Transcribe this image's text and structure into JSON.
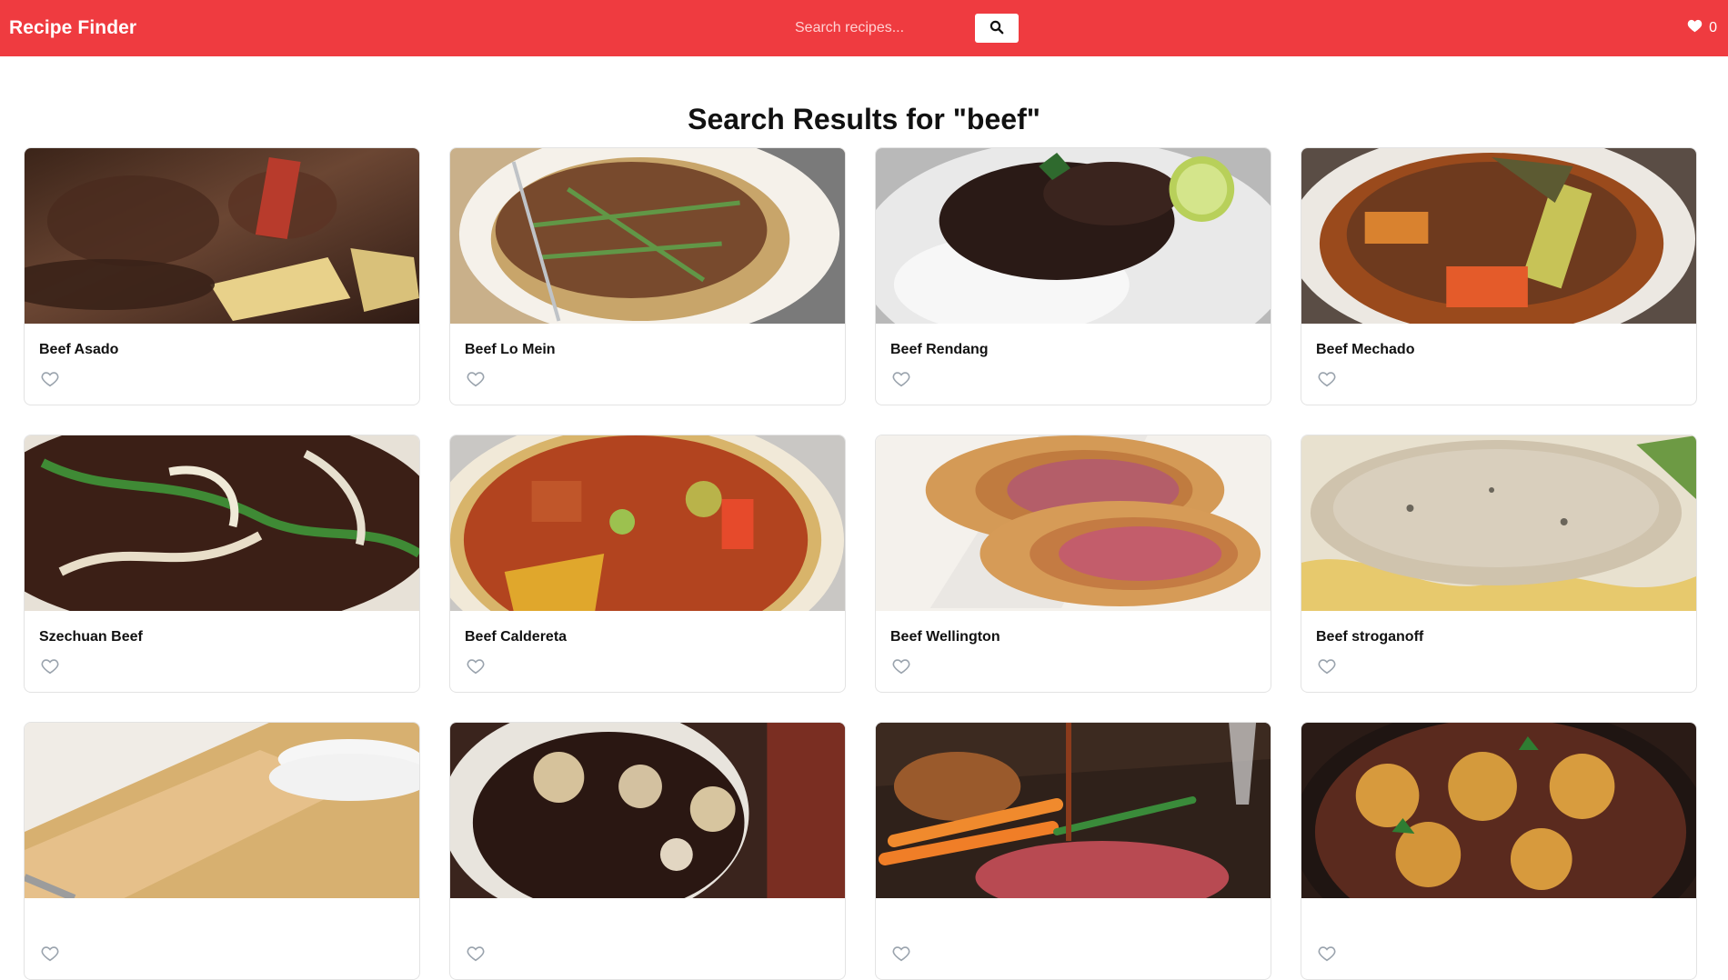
{
  "app": {
    "title": "Recipe Finder",
    "accent": "#ef3b40"
  },
  "search": {
    "placeholder": "Search recipes...",
    "button_icon": "search-icon"
  },
  "favorites": {
    "icon": "heart-icon",
    "count": "0"
  },
  "results": {
    "heading": "Search Results for \"beef\"",
    "items": [
      {
        "title": "Beef Asado",
        "image_icon": "recipe-photo",
        "fav_icon": "heart-outline-icon"
      },
      {
        "title": "Beef Lo Mein",
        "image_icon": "recipe-photo",
        "fav_icon": "heart-outline-icon"
      },
      {
        "title": "Beef Rendang",
        "image_icon": "recipe-photo",
        "fav_icon": "heart-outline-icon"
      },
      {
        "title": "Beef Mechado",
        "image_icon": "recipe-photo",
        "fav_icon": "heart-outline-icon"
      },
      {
        "title": "Szechuan Beef",
        "image_icon": "recipe-photo",
        "fav_icon": "heart-outline-icon"
      },
      {
        "title": "Beef Caldereta",
        "image_icon": "recipe-photo",
        "fav_icon": "heart-outline-icon"
      },
      {
        "title": "Beef Wellington",
        "image_icon": "recipe-photo",
        "fav_icon": "heart-outline-icon"
      },
      {
        "title": "Beef stroganoff",
        "image_icon": "recipe-photo",
        "fav_icon": "heart-outline-icon"
      },
      {
        "title": "",
        "image_icon": "recipe-photo",
        "fav_icon": "heart-outline-icon"
      },
      {
        "title": "",
        "image_icon": "recipe-photo",
        "fav_icon": "heart-outline-icon"
      },
      {
        "title": "",
        "image_icon": "recipe-photo",
        "fav_icon": "heart-outline-icon"
      },
      {
        "title": "",
        "image_icon": "recipe-photo",
        "fav_icon": "heart-outline-icon"
      }
    ]
  }
}
